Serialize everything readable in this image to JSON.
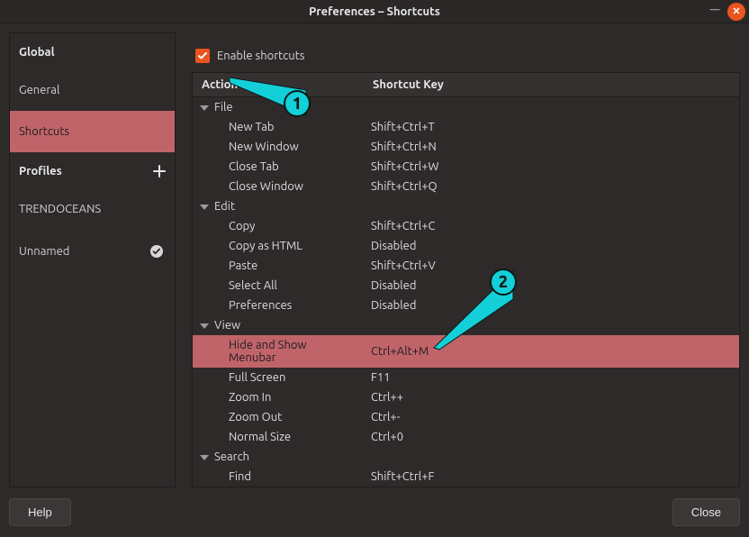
{
  "window_title": "Preferences – Shortcuts",
  "sidebar": {
    "global_header": "Global",
    "items": [
      "General",
      "Shortcuts"
    ],
    "profiles_header": "Profiles",
    "profiles": [
      "TRENDOCEANS",
      "Unnamed"
    ]
  },
  "enable_shortcuts_label": "Enable shortcuts",
  "table": {
    "col_action": "Action",
    "col_key": "Shortcut Key",
    "groups": [
      {
        "name": "File",
        "items": [
          {
            "action": "New Tab",
            "key": "Shift+Ctrl+T"
          },
          {
            "action": "New Window",
            "key": "Shift+Ctrl+N"
          },
          {
            "action": "Close Tab",
            "key": "Shift+Ctrl+W"
          },
          {
            "action": "Close Window",
            "key": "Shift+Ctrl+Q"
          }
        ]
      },
      {
        "name": "Edit",
        "items": [
          {
            "action": "Copy",
            "key": "Shift+Ctrl+C"
          },
          {
            "action": "Copy as HTML",
            "key": "Disabled"
          },
          {
            "action": "Paste",
            "key": "Shift+Ctrl+V"
          },
          {
            "action": "Select All",
            "key": "Disabled"
          },
          {
            "action": "Preferences",
            "key": "Disabled"
          }
        ]
      },
      {
        "name": "View",
        "items": [
          {
            "action": "Hide and Show Menubar",
            "key": "Ctrl+Alt+M",
            "selected": true
          },
          {
            "action": "Full Screen",
            "key": "F11"
          },
          {
            "action": "Zoom In",
            "key": "Ctrl++"
          },
          {
            "action": "Zoom Out",
            "key": "Ctrl+-"
          },
          {
            "action": "Normal Size",
            "key": "Ctrl+0"
          }
        ]
      },
      {
        "name": "Search",
        "items": [
          {
            "action": "Find",
            "key": "Shift+Ctrl+F"
          }
        ]
      }
    ]
  },
  "buttons": {
    "help": "Help",
    "close": "Close"
  },
  "annotations": {
    "a1": "1",
    "a2": "2"
  }
}
